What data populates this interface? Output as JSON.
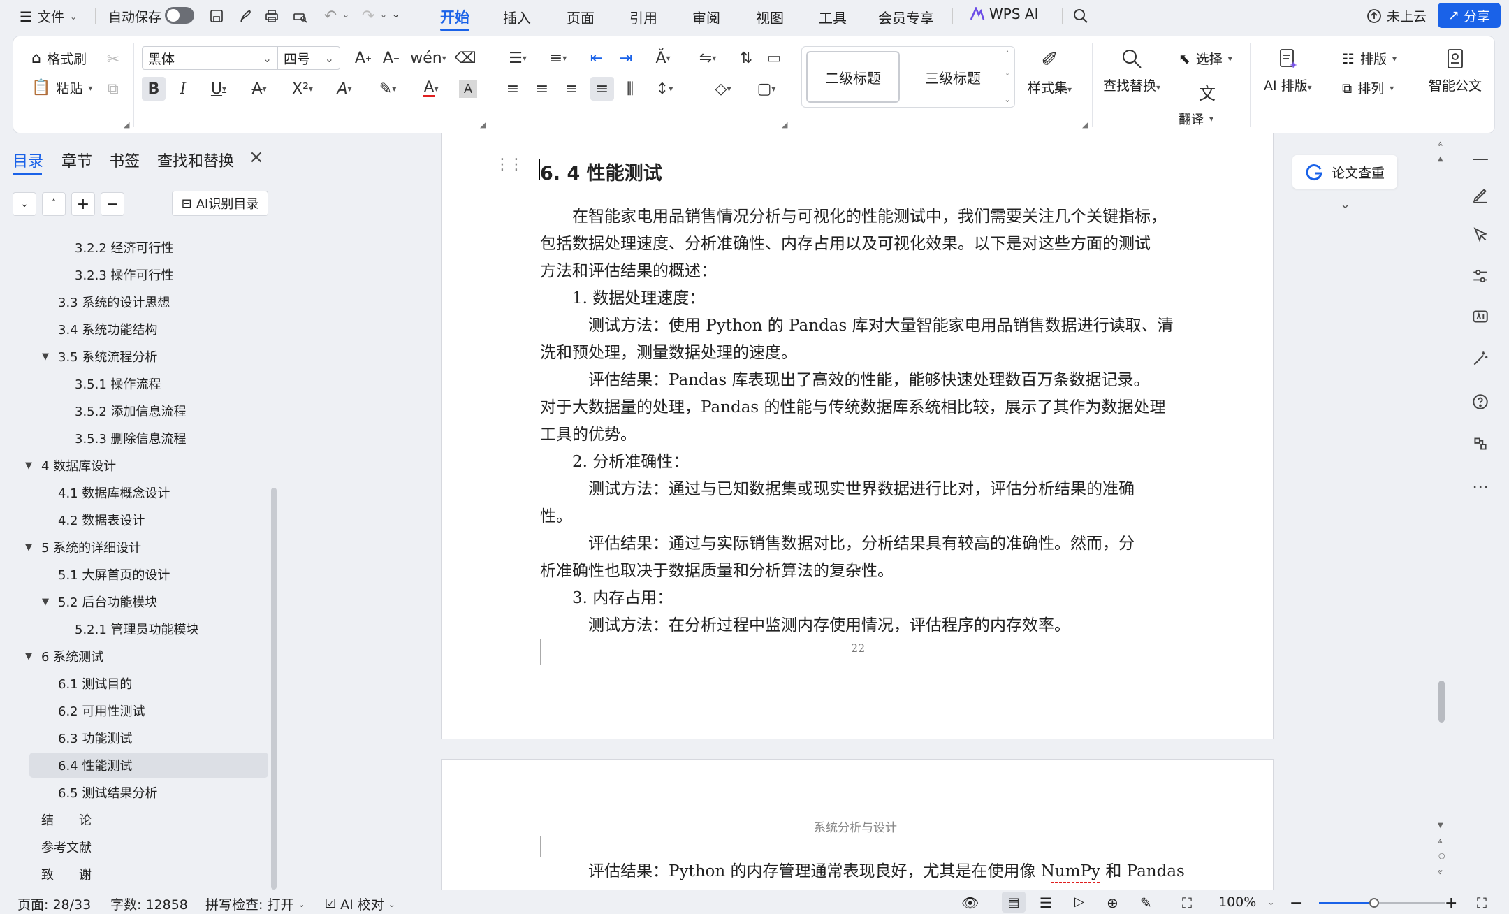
{
  "menubar": {
    "file": "文件",
    "autosave": "自动保存",
    "tabs": [
      "开始",
      "插入",
      "页面",
      "引用",
      "审阅",
      "视图",
      "工具",
      "会员专享",
      "WPS AI"
    ],
    "cloud": "未上云",
    "share": "分享"
  },
  "ribbon": {
    "format_painter": "格式刷",
    "paste": "粘贴",
    "font_name": "黑体",
    "font_size": "四号",
    "style1": "二级标题",
    "style2": "三级标题",
    "styles_set": "样式集",
    "find_replace": "查找替换",
    "select": "选择",
    "translate": "翻译",
    "ai_layout": "AI 排版",
    "layout": "排版",
    "arrange": "排列",
    "smart_doc": "智能公文"
  },
  "nav": {
    "tabs": [
      "目录",
      "章节",
      "书签",
      "查找和替换"
    ],
    "ai_toc": "AI识别目录",
    "items": [
      "3.2.2 经济可行性",
      "3.2.3 操作可行性",
      "3.3 系统的设计思想",
      "3.4 系统功能结构",
      "3.5 系统流程分析",
      "3.5.1 操作流程",
      "3.5.2 添加信息流程",
      "3.5.3 删除信息流程",
      "4 数据库设计",
      "4.1 数据库概念设计",
      "4.2 数据表设计",
      "5 系统的详细设计",
      "5.1 大屏首页的设计",
      "5.2 后台功能模块",
      "5.2.1 管理员功能模块",
      "6 系统测试",
      "6.1 测试目的",
      "6.2 可用性测试",
      "6.3 功能测试",
      "6.4 性能测试",
      "6.5 测试结果分析",
      "结　　论",
      "参考文献",
      "致　　谢"
    ]
  },
  "doc": {
    "heading": "6. 4 性能测试",
    "lines": [
      "　　在智能家电用品销售情况分析与可视化的性能测试中，我们需要关注几个关键指标，",
      "包括数据处理速度、分析准确性、内存占用以及可视化效果。以下是对这些方面的测试",
      "方法和评估结果的概述：",
      "　　1.  数据处理速度：",
      "　　　测试方法：使用 Python 的 Pandas 库对大量智能家电用品销售数据进行读取、清",
      "洗和预处理，测量数据处理的速度。",
      "　　　评估结果：Pandas 库表现出了高效的性能，能够快速处理数百万条数据记录。",
      "对于大数据量的处理，Pandas 的性能与传统数据库系统相比较，展示了其作为数据处理",
      "工具的优势。",
      "　　2.  分析准确性：",
      "　　　测试方法：通过与已知数据集或现实世界数据进行比对，评估分析结果的准确",
      "性。",
      "　　　评估结果：通过与实际销售数据对比，分析结果具有较高的准确性。然而，分",
      "析准确性也取决于数据质量和分析算法的复杂性。",
      "　　3.  内存占用：",
      "　　　测试方法：在分析过程中监测内存使用情况，评估程序的内存效率。"
    ],
    "page_number": "22",
    "page2_header": "系统分析与设计",
    "page2_line": "　　　评估结果：Python 的内存管理通常表现良好，尤其是在使用像 NumPy 和 Pandas",
    "right_panel_button": "论文查重"
  },
  "status": {
    "page": "页面: 28/33",
    "words": "字数: 12858",
    "spell": "拼写检查: 打开",
    "ai_check": "AI 校对",
    "zoom": "100%"
  },
  "colors": {
    "accent": "#1a62e8",
    "share_bg": "#1a62e8",
    "selected_item": "#dcdfe5"
  }
}
